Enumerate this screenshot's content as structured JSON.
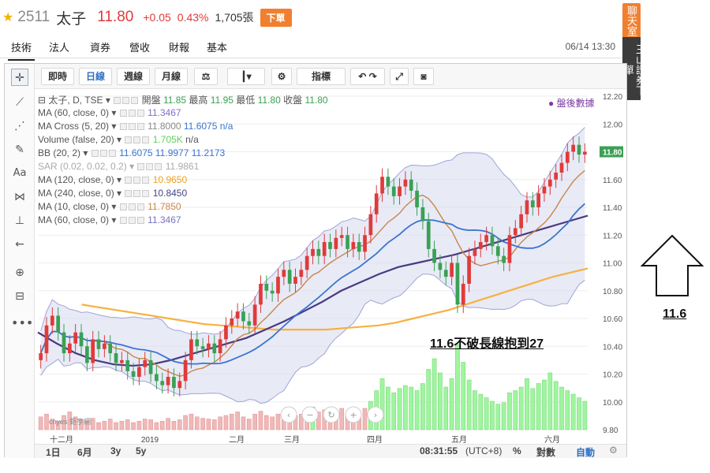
{
  "header": {
    "code": "2511",
    "name": "太子",
    "price": "11.80",
    "change": "+0.05",
    "change_pct": "0.43%",
    "volume": "1,705張",
    "order_button": "下單"
  },
  "tabs": [
    {
      "label": "技術",
      "active": true
    },
    {
      "label": "法人",
      "active": false
    },
    {
      "label": "資券",
      "active": false
    },
    {
      "label": "營收",
      "active": false
    },
    {
      "label": "財報",
      "active": false
    },
    {
      "label": "基本",
      "active": false
    }
  ],
  "datetime": "06/14 13:30",
  "side_tabs": {
    "chat": "聊天室",
    "order": "玉山證券下單"
  },
  "toolbar": {
    "buttons": [
      "即時",
      "日線",
      "週線",
      "月線"
    ],
    "active": "日線",
    "indicator_label": "指標"
  },
  "legend": {
    "symbol": "太子, D, TSE",
    "open_label": "開盤",
    "open": "11.85",
    "high_label": "最高",
    "high": "11.95",
    "low_label": "最低",
    "low": "11.80",
    "close_label": "收盤",
    "close": "11.80",
    "after_hours": "● 盤後數據",
    "rows": [
      {
        "name": "MA (60, close, 0)",
        "values": [
          {
            "v": "11.3467",
            "color": "#7a72c0"
          }
        ]
      },
      {
        "name": "MA Cross (5, 20)",
        "values": [
          {
            "v": "11.8000",
            "color": "#8a8a8a"
          },
          {
            "v": "11.6075",
            "color": "#3a74d0"
          },
          {
            "v": "n/a",
            "color": "#3a74d0"
          }
        ]
      },
      {
        "name": "Volume (false, 20)",
        "values": [
          {
            "v": "1.705K",
            "color": "#5fd05f"
          },
          {
            "v": "n/a",
            "color": "#555555"
          }
        ]
      },
      {
        "name": "BB (20, 2)",
        "values": [
          {
            "v": "11.6075",
            "color": "#3a74d0"
          },
          {
            "v": "11.9977",
            "color": "#3a74d0"
          },
          {
            "v": "11.2173",
            "color": "#3a74d0"
          }
        ]
      },
      {
        "name": "SAR (0.02, 0.02, 0.2)",
        "values": [
          {
            "v": "11.9861",
            "color": "#aaaaaa"
          }
        ],
        "faded": true
      },
      {
        "name": "MA (120, close, 0)",
        "values": [
          {
            "v": "10.9650",
            "color": "#f0a020"
          }
        ]
      },
      {
        "name": "MA (240, close, 0)",
        "values": [
          {
            "v": "10.8450",
            "color": "#444488"
          }
        ]
      },
      {
        "name": "MA (10, close, 0)",
        "values": [
          {
            "v": "11.7850",
            "color": "#c8864a"
          }
        ]
      },
      {
        "name": "MA (60, close, 0)",
        "values": [
          {
            "v": "11.3467",
            "color": "#7a72c0"
          }
        ]
      }
    ]
  },
  "y_axis_labels": [
    "12.20",
    "12.00",
    "11.80",
    "11.60",
    "11.40",
    "11.20",
    "11.00",
    "10.80",
    "10.60",
    "10.40",
    "10.20",
    "10.00",
    "9.80"
  ],
  "last_price_tag": "11.80",
  "x_axis_labels": [
    "十二月",
    "2019",
    "二月",
    "三月",
    "四月",
    "五月",
    "六月"
  ],
  "bottom": {
    "ranges": [
      "1日",
      "6月",
      "3y",
      "5y"
    ],
    "clock": "08:31:55",
    "tz": "(UTC+8)",
    "pct": "%",
    "log": "對數",
    "auto": "自動"
  },
  "watermark": "cnyes 鉅亨網",
  "annotation": "11.6不破長線抱到27",
  "arrow_label": "11.6",
  "colors": {
    "up": "#e03a3a",
    "down": "#3aa055",
    "accent": "#f08030",
    "band_fill": "#d8dcf0"
  },
  "chart_data": {
    "type": "candlestick",
    "ylim": [
      9.8,
      12.2
    ],
    "y_ticks": [
      9.8,
      10.0,
      10.2,
      10.4,
      10.6,
      10.8,
      11.0,
      11.2,
      11.4,
      11.6,
      11.8,
      12.0,
      12.2
    ],
    "x_tick_labels": [
      "十二月",
      "2019",
      "二月",
      "三月",
      "四月",
      "五月",
      "六月"
    ],
    "close_series": [
      10.35,
      10.55,
      10.62,
      10.5,
      10.35,
      10.42,
      10.5,
      10.4,
      10.28,
      10.45,
      10.38,
      10.42,
      10.35,
      10.28,
      10.3,
      10.22,
      10.18,
      10.25,
      10.3,
      10.2,
      10.15,
      10.12,
      10.18,
      10.1,
      10.15,
      10.3,
      10.45,
      10.4,
      10.38,
      10.42,
      10.35,
      10.45,
      10.55,
      10.6,
      10.65,
      10.58,
      10.55,
      10.7,
      10.85,
      10.8,
      10.78,
      10.9,
      10.95,
      10.85,
      10.9,
      10.95,
      11.05,
      11.1,
      11.05,
      11.15,
      11.1,
      11.18,
      11.2,
      11.1,
      11.15,
      11.08,
      11.2,
      11.35,
      11.5,
      11.62,
      11.55,
      11.48,
      11.55,
      11.6,
      11.52,
      11.4,
      11.3,
      11.1,
      11.0,
      10.95,
      10.9,
      11.0,
      10.7,
      10.85,
      11.05,
      11.1,
      11.15,
      11.2,
      11.12,
      11.05,
      11.0,
      11.2,
      11.25,
      11.35,
      11.45,
      11.4,
      11.5,
      11.55,
      11.6,
      11.65,
      11.72,
      11.8,
      11.85,
      11.78,
      11.8
    ],
    "volume_series": [
      0.18,
      0.22,
      0.15,
      0.12,
      0.2,
      0.25,
      0.18,
      0.14,
      0.12,
      0.16,
      0.1,
      0.12,
      0.15,
      0.1,
      0.12,
      0.14,
      0.1,
      0.12,
      0.15,
      0.14,
      0.1,
      0.12,
      0.16,
      0.12,
      0.14,
      0.2,
      0.22,
      0.18,
      0.16,
      0.15,
      0.14,
      0.18,
      0.2,
      0.22,
      0.25,
      0.18,
      0.15,
      0.22,
      0.26,
      0.2,
      0.18,
      0.22,
      0.25,
      0.18,
      0.2,
      0.22,
      0.3,
      0.32,
      0.25,
      0.28,
      0.22,
      0.26,
      0.3,
      0.22,
      0.24,
      0.2,
      0.3,
      0.4,
      0.55,
      0.72,
      0.6,
      0.52,
      0.58,
      0.62,
      0.6,
      0.55,
      0.65,
      0.85,
      1.0,
      0.8,
      0.6,
      0.72,
      1.2,
      0.95,
      0.7,
      0.55,
      0.5,
      0.45,
      0.4,
      0.36,
      0.38,
      0.52,
      0.55,
      0.6,
      0.72,
      0.58,
      0.65,
      0.7,
      0.8,
      0.68,
      0.6,
      0.55,
      0.5,
      0.45,
      0.4
    ],
    "ma120_series": [
      10.7,
      10.68,
      10.66,
      10.64,
      10.62,
      10.6,
      10.58,
      10.56,
      10.55,
      10.54,
      10.53,
      10.52,
      10.52,
      10.52,
      10.52,
      10.53,
      10.54,
      10.55,
      10.57,
      10.6,
      10.63,
      10.66,
      10.7,
      10.74,
      10.78,
      10.82,
      10.86,
      10.9,
      10.93,
      10.96
    ],
    "ma240_series": [
      10.5,
      10.42,
      10.35,
      10.3,
      10.27,
      10.26,
      10.27,
      10.3,
      10.34,
      10.38,
      10.42,
      10.46,
      10.52,
      10.58,
      10.65,
      10.72,
      10.8,
      10.86,
      10.92,
      10.97,
      11.0,
      11.03,
      11.06,
      11.1,
      11.14,
      11.18,
      11.22,
      11.26,
      11.3,
      11.34
    ]
  }
}
